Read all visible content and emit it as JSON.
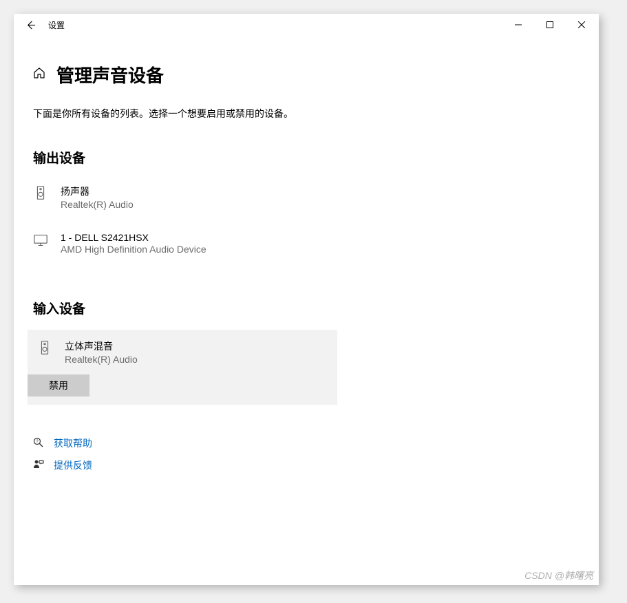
{
  "window": {
    "app_title": "设置"
  },
  "page": {
    "title": "管理声音设备",
    "description": "下面是你所有设备的列表。选择一个想要启用或禁用的设备。"
  },
  "sections": {
    "output": {
      "title": "输出设备",
      "devices": [
        {
          "name": "扬声器",
          "sub": "Realtek(R) Audio"
        },
        {
          "name": "1 - DELL S2421HSX",
          "sub": "AMD High Definition Audio Device"
        }
      ]
    },
    "input": {
      "title": "输入设备",
      "selected": {
        "name": "立体声混音",
        "sub": "Realtek(R) Audio"
      },
      "action_label": "禁用"
    }
  },
  "help": {
    "get_help": "获取帮助",
    "feedback": "提供反馈"
  },
  "watermark": "CSDN @韩曙亮"
}
